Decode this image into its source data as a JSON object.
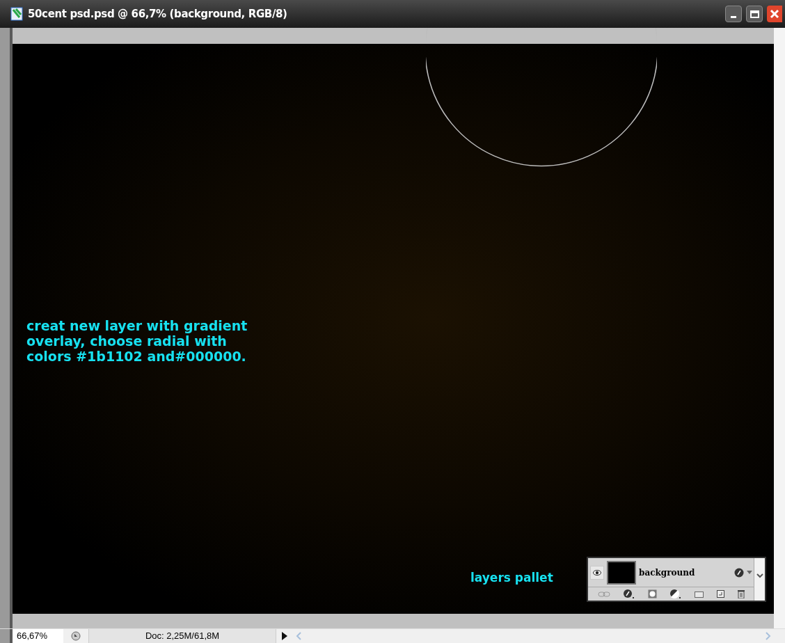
{
  "window": {
    "title": "50cent psd.psd @ 66,7% (background, RGB/8)"
  },
  "canvas": {
    "note": "creat new layer with gradient overlay, choose radial with colors #1b1102 and#000000.",
    "palette_label": "layers pallet"
  },
  "layers_palette": {
    "layers": [
      {
        "name": "background",
        "visible": true
      }
    ]
  },
  "status_bar": {
    "zoom": "66,67%",
    "doc_info": "Doc: 2,25M/61,8M"
  }
}
